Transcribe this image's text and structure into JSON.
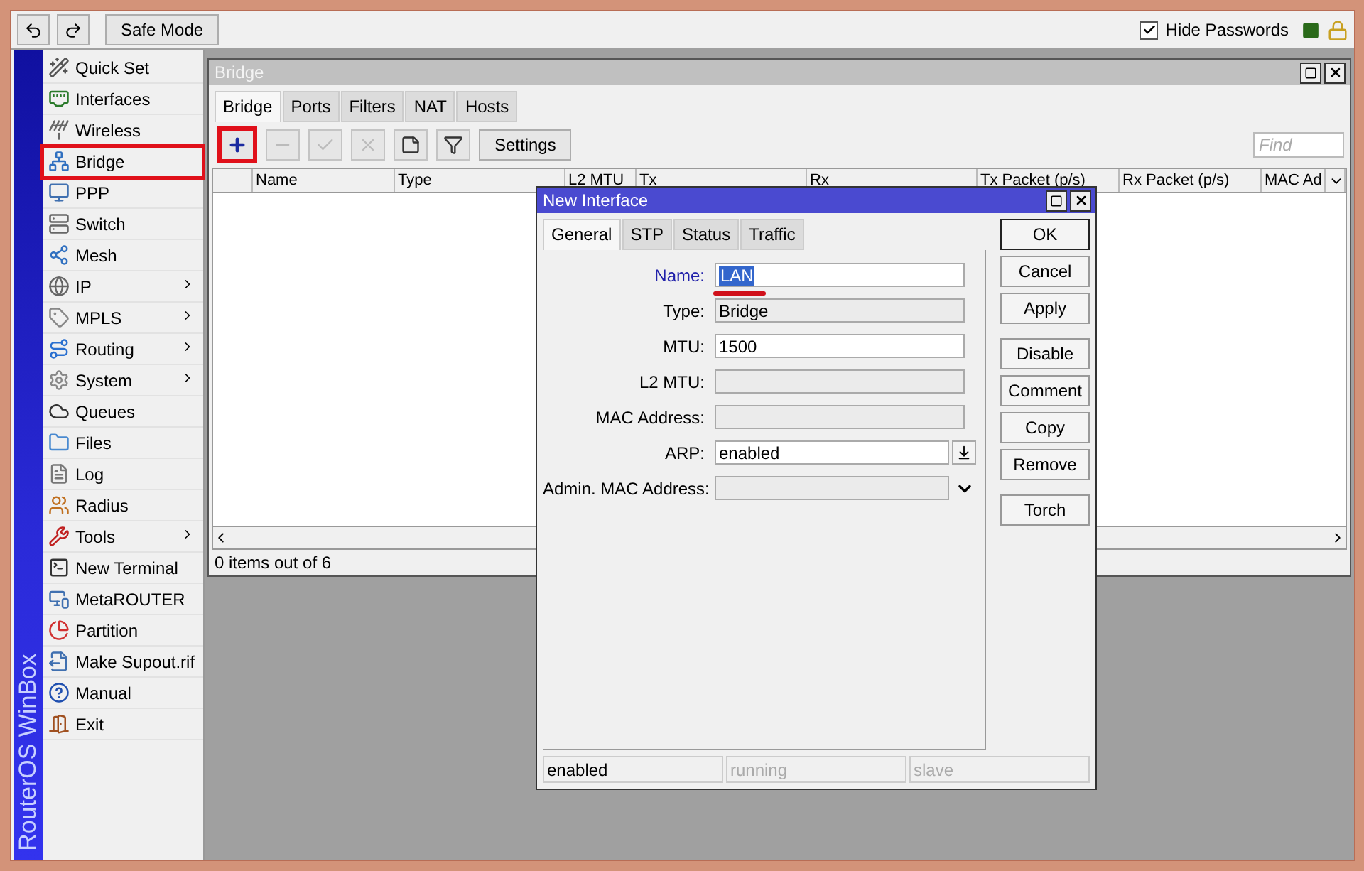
{
  "toolbar": {
    "safe_mode": "Safe Mode",
    "hide_passwords": {
      "label": "Hide Passwords",
      "checked": true
    }
  },
  "banner": "RouterOS WinBox",
  "menu": [
    {
      "label": "Quick Set",
      "submenu": false,
      "highlighted": false
    },
    {
      "label": "Interfaces",
      "submenu": false,
      "highlighted": false
    },
    {
      "label": "Wireless",
      "submenu": false,
      "highlighted": false
    },
    {
      "label": "Bridge",
      "submenu": false,
      "highlighted": true
    },
    {
      "label": "PPP",
      "submenu": false,
      "highlighted": false
    },
    {
      "label": "Switch",
      "submenu": false,
      "highlighted": false
    },
    {
      "label": "Mesh",
      "submenu": false,
      "highlighted": false
    },
    {
      "label": "IP",
      "submenu": true,
      "highlighted": false
    },
    {
      "label": "MPLS",
      "submenu": true,
      "highlighted": false
    },
    {
      "label": "Routing",
      "submenu": true,
      "highlighted": false
    },
    {
      "label": "System",
      "submenu": true,
      "highlighted": false
    },
    {
      "label": "Queues",
      "submenu": false,
      "highlighted": false
    },
    {
      "label": "Files",
      "submenu": false,
      "highlighted": false
    },
    {
      "label": "Log",
      "submenu": false,
      "highlighted": false
    },
    {
      "label": "Radius",
      "submenu": false,
      "highlighted": false
    },
    {
      "label": "Tools",
      "submenu": true,
      "highlighted": false
    },
    {
      "label": "New Terminal",
      "submenu": false,
      "highlighted": false
    },
    {
      "label": "MetaROUTER",
      "submenu": false,
      "highlighted": false
    },
    {
      "label": "Partition",
      "submenu": false,
      "highlighted": false
    },
    {
      "label": "Make Supout.rif",
      "submenu": false,
      "highlighted": false
    },
    {
      "label": "Manual",
      "submenu": false,
      "highlighted": false
    },
    {
      "label": "Exit",
      "submenu": false,
      "highlighted": false
    }
  ],
  "bridge_window": {
    "title": "Bridge",
    "tabs": [
      {
        "label": "Bridge",
        "selected": true
      },
      {
        "label": "Ports",
        "selected": false
      },
      {
        "label": "Filters",
        "selected": false
      },
      {
        "label": "NAT",
        "selected": false
      },
      {
        "label": "Hosts",
        "selected": false
      }
    ],
    "tools": [
      {
        "kind": "add",
        "disabled": false,
        "highlighted": true
      },
      {
        "kind": "remove",
        "disabled": true,
        "highlighted": false
      },
      {
        "kind": "enable",
        "disabled": true,
        "highlighted": false
      },
      {
        "kind": "disable",
        "disabled": true,
        "highlighted": false
      },
      {
        "kind": "comment",
        "disabled": false,
        "highlighted": false
      },
      {
        "kind": "filter",
        "disabled": false,
        "highlighted": false
      }
    ],
    "settings": "Settings",
    "find": {
      "placeholder": "Find"
    },
    "columns": [
      "Name",
      "Type",
      "L2 MTU",
      "Tx",
      "Rx",
      "Tx Packet (p/s)",
      "Rx Packet (p/s)",
      "MAC Ad"
    ],
    "status": "0 items out of 6"
  },
  "dialog": {
    "title": "New Interface",
    "tabs": [
      {
        "label": "General",
        "selected": true
      },
      {
        "label": "STP",
        "selected": false
      },
      {
        "label": "Status",
        "selected": false
      },
      {
        "label": "Traffic",
        "selected": false
      }
    ],
    "fields": [
      {
        "label": "Name:",
        "kind": "text",
        "value": "LAN",
        "focused": true,
        "underlined": true
      },
      {
        "label": "Type:",
        "kind": "readonly",
        "value": "Bridge",
        "focused": false,
        "underlined": false
      },
      {
        "label": "MTU:",
        "kind": "text",
        "value": "1500",
        "focused": false,
        "underlined": false
      },
      {
        "label": "L2 MTU:",
        "kind": "readonly",
        "focused": false,
        "underlined": false
      },
      {
        "label": "MAC Address:",
        "kind": "readonly",
        "focused": false,
        "underlined": false
      },
      {
        "label": "ARP:",
        "kind": "select",
        "value": "enabled",
        "focused": false,
        "underlined": false
      },
      {
        "label": "Admin. MAC Address:",
        "kind": "dropdown",
        "focused": false,
        "underlined": false
      }
    ],
    "button_groups": [
      [
        {
          "label": "OK",
          "default": true
        },
        {
          "label": "Cancel",
          "default": false
        },
        {
          "label": "Apply",
          "default": false
        }
      ],
      [
        {
          "label": "Disable",
          "default": false
        },
        {
          "label": "Comment",
          "default": false
        },
        {
          "label": "Copy",
          "default": false
        },
        {
          "label": "Remove",
          "default": false
        }
      ],
      [
        {
          "label": "Torch",
          "default": false
        }
      ]
    ],
    "status": [
      {
        "text": "enabled",
        "disabled": false
      },
      {
        "text": "running",
        "disabled": true
      },
      {
        "text": "slave",
        "disabled": true
      }
    ]
  }
}
